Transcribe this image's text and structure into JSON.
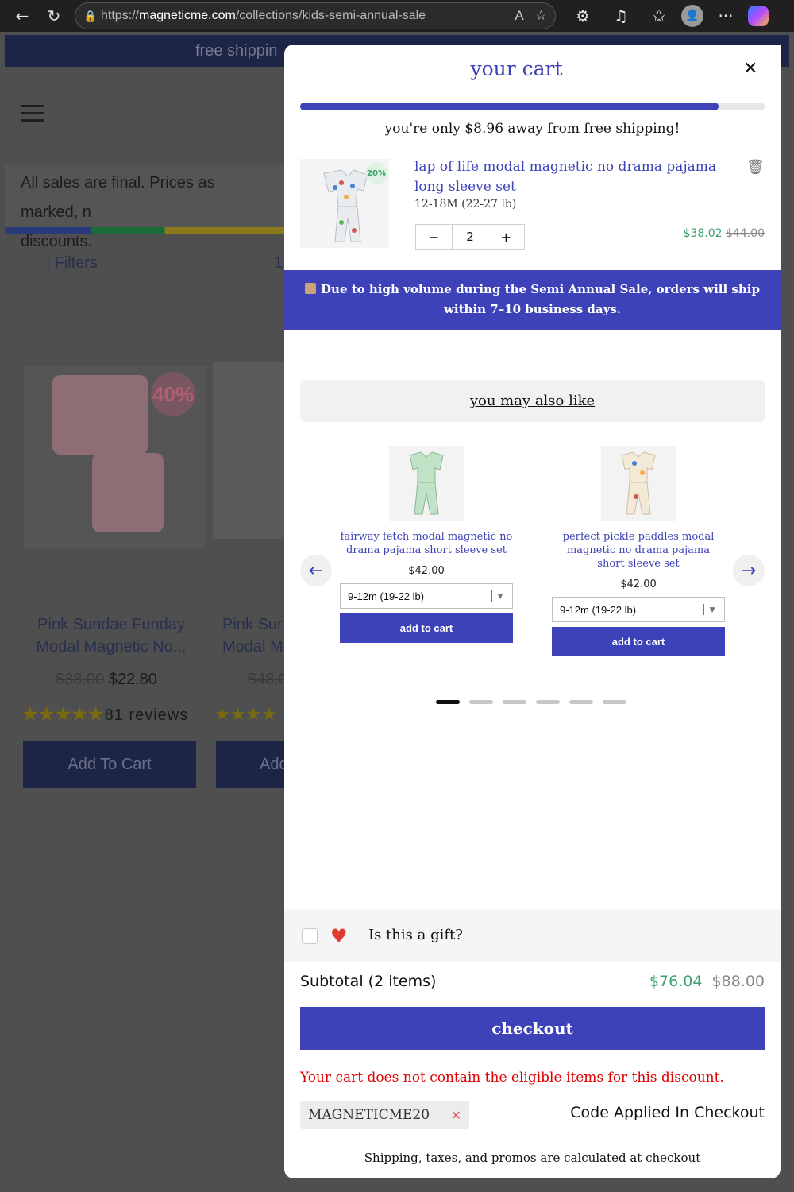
{
  "browser": {
    "url_prefix": "https://",
    "url_host": "magneticme.com",
    "url_path": "/collections/kids-semi-annual-sale"
  },
  "background_page": {
    "banner": "free shippin",
    "notice_line1": "All sales are final. Prices as marked, n",
    "notice_line2": "discounts.",
    "filters_label": "Filters",
    "count_fragment": "1",
    "badge": "40%",
    "product1": {
      "title": "Pink Sundae Funday Modal Magnetic No...",
      "old_price": "$38.00",
      "price": "$22.80",
      "stars": "★★★★★",
      "reviews": "81 reviews",
      "button": "Add To Cart"
    },
    "product2": {
      "title_line1": "Pink Sur",
      "title_line2": "Modal M",
      "old_price": "$48.0",
      "stars": "★★★★",
      "button": "Add"
    }
  },
  "cart": {
    "title": "your cart",
    "progress": 0.9,
    "shipping_message": "you're only $8.96 away from free shipping!",
    "item": {
      "badge": "20%",
      "name": "lap of life modal magnetic no drama pajama long sleeve set",
      "variant": "12-18M (22-27 lb)",
      "quantity": "2",
      "price": "$38.02",
      "compare_price": "$44.00"
    },
    "notice": "Due to high volume during the Semi Annual Sale, orders will ship within 7–10 business days.",
    "recommendations_heading": "you may also like",
    "recommendations": [
      {
        "name": "fairway fetch modal magnetic no drama pajama short sleeve set",
        "price": "$42.00",
        "size": "9-12m (19-22 lb)",
        "button": "add to cart"
      },
      {
        "name": "perfect pickle paddles modal magnetic no drama pajama short sleeve set",
        "price": "$42.00",
        "size": "9-12m (19-22 lb)",
        "button": "add to cart"
      }
    ],
    "gift_label": "Is this a gift?",
    "subtotal_label": "Subtotal (2 items)",
    "subtotal": "$76.04",
    "subtotal_compare": "$88.00",
    "checkout": "checkout",
    "discount_error": "Your cart does not contain the eligible items for this discount.",
    "discount_code": "MAGNETICME20",
    "code_applied": "Code Applied In Checkout",
    "footnote": "Shipping, taxes, and promos are calculated at checkout"
  },
  "colors": {
    "brand": "#3d42b9",
    "sale_green": "#3aa26a",
    "error": "#e00000"
  }
}
